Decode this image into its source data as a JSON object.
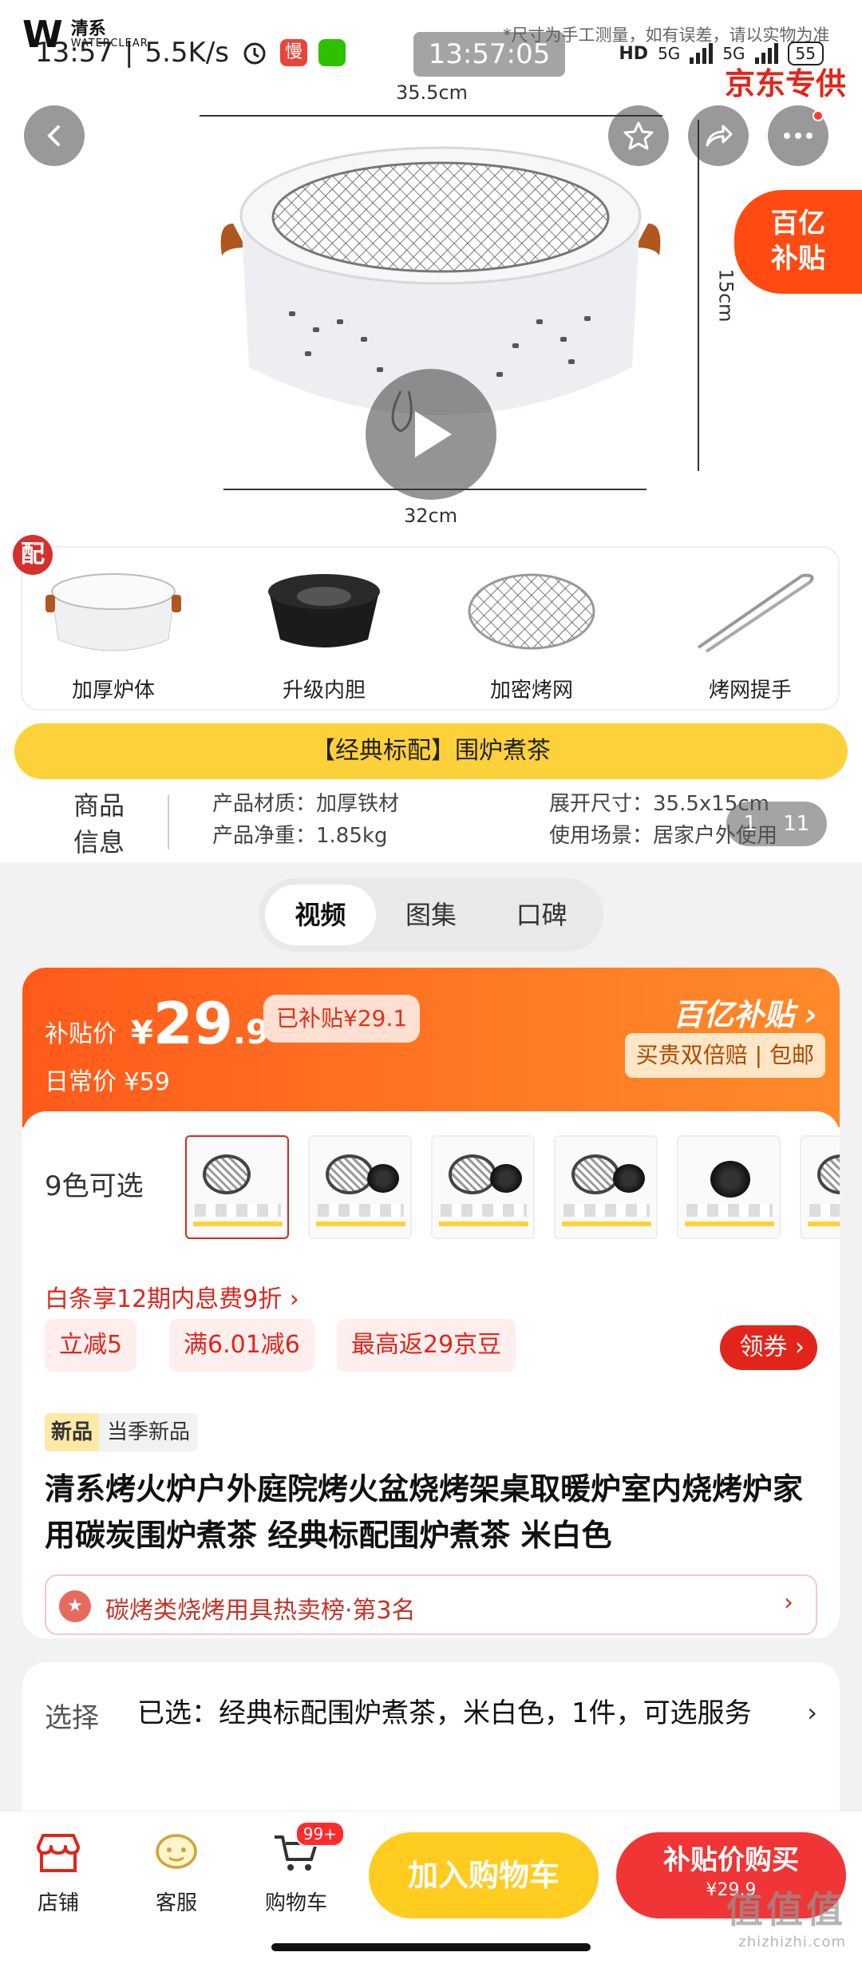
{
  "status_bar": {
    "time_left": "13:57",
    "speed": "5.5K/s",
    "app_badge": "慢",
    "time_center": "13:57:05",
    "hd": "HD",
    "net1": "5G",
    "net2": "5G",
    "battery": "55"
  },
  "hero": {
    "brand_name": "清系",
    "brand_sub": "WATERCLEAR",
    "disclaimer": "*尺寸为手工测量，如有误差，请以实物为准",
    "jd_logo": "京东专供",
    "dim_width_top": "35.5cm",
    "dim_height": "15cm",
    "dim_width_bottom": "32cm",
    "subsidy_badge_line1": "百亿",
    "subsidy_badge_line2": "补贴",
    "accessory_badge": "配",
    "accessories": [
      {
        "label": "加厚炉体"
      },
      {
        "label": "升级内胆"
      },
      {
        "label": "加密烤网"
      },
      {
        "label": "烤网提手"
      }
    ],
    "classic_bar": "【经典标配】围炉煮茶",
    "info_title_1": "商品",
    "info_title_2": "信息",
    "specs": {
      "material": "产品材质：加厚铁材",
      "size": "展开尺寸：35.5x15cm",
      "weight": "产品净重：1.85kg",
      "scene": "使用场景：居家户外使用"
    },
    "page_current": "1",
    "page_total": "11"
  },
  "tabs": [
    {
      "label": "视频",
      "active": true
    },
    {
      "label": "图集",
      "active": false
    },
    {
      "label": "口碑",
      "active": false
    }
  ],
  "price": {
    "label": "补贴价",
    "currency": "¥",
    "integer": "29",
    "decimal": ".9",
    "subsidized_tag": "已补贴¥29.1",
    "daily_price": "日常价 ¥59",
    "brand": "百亿补贴 ›",
    "guarantee": "买贵双倍赔 | 包邮"
  },
  "options": {
    "colors_label": "9色可选",
    "baitiao": "白条享12期内息费9折 ›",
    "promos": [
      "立减5",
      "满6.01减6",
      "最高返29京豆"
    ],
    "coupon_button": "领券 ›",
    "new_tag_a": "新品",
    "new_tag_b": "当季新品",
    "title": "清系烤火炉户外庭院烤火盆烧烤架桌取暖炉室内烧烤炉家用碳炭围炉煮茶 经典标配围炉煮茶 米白色",
    "rank": "碳烤类烧烤用具热卖榜·第3名",
    "rank_arrow": "›"
  },
  "selection": {
    "label": "选择",
    "value": "已选：经典标配围炉煮茶，米白色，1件，可选服务",
    "arrow": "›"
  },
  "bottom_bar": {
    "store": "店铺",
    "service": "客服",
    "cart": "购物车",
    "cart_badge": "99+",
    "add_to_cart": "加入购物车",
    "buy_now": "补贴价购买",
    "buy_now_price": "¥29.9"
  },
  "watermark": {
    "text": "值值值",
    "url": "zhizhizhi.com"
  },
  "colors": {
    "accent_red": "#e1251b",
    "subsidy_orange": "#ff5a1a",
    "yellow": "#ffcc1f"
  }
}
